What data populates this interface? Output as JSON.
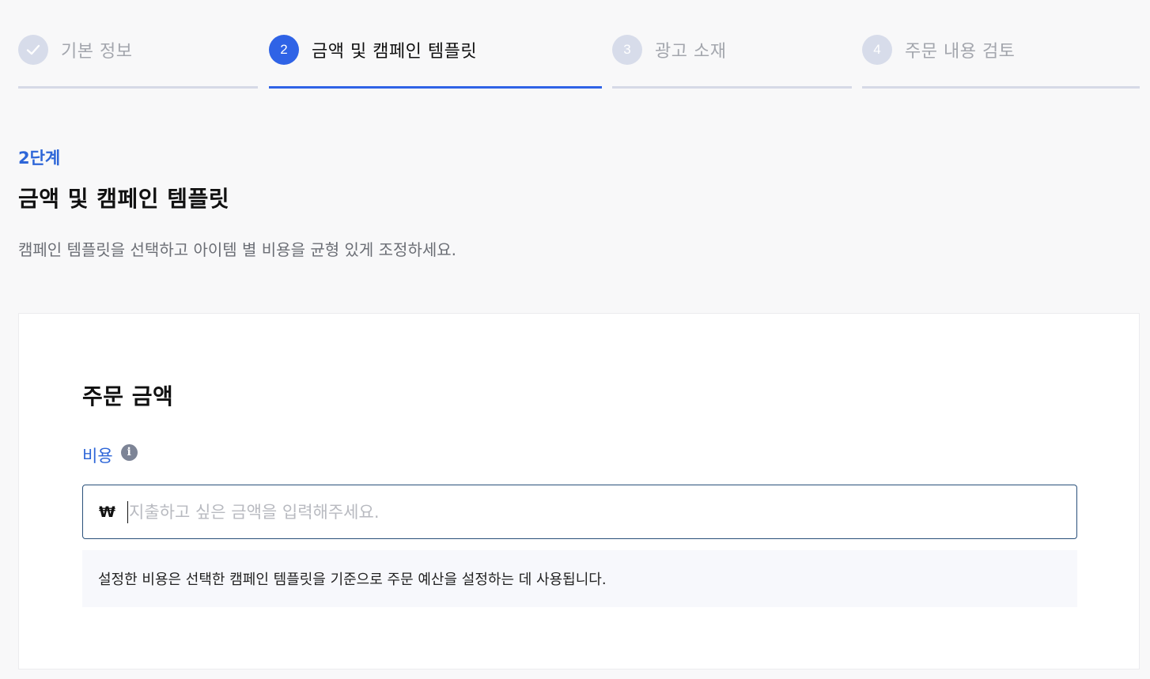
{
  "stepper": {
    "steps": [
      {
        "number": "✓",
        "label": "기본 정보",
        "state": "done"
      },
      {
        "number": "2",
        "label": "금액 및 캠페인 템플릿",
        "state": "active"
      },
      {
        "number": "3",
        "label": "광고 소재",
        "state": "todo"
      },
      {
        "number": "4",
        "label": "주문 내용 검토",
        "state": "todo"
      }
    ]
  },
  "header": {
    "stage": "2단계",
    "title": "금액 및 캠페인 템플릿",
    "description": "캠페인 템플릿을 선택하고 아이템 별 비용을 균형 있게 조정하세요."
  },
  "order_amount": {
    "title": "주문 금액",
    "cost_label": "비용",
    "info_icon": "info-icon",
    "currency_symbol": "₩",
    "input_value": "",
    "input_placeholder": "지출하고 싶은 금액을 입력해주세요.",
    "help_text": "설정한 비용은 선택한 캠페인 템플릿을 기준으로 주문 예산을 설정하는 데 사용됩니다."
  },
  "colors": {
    "accent": "#2f63e6",
    "label_blue": "#2e66d8",
    "inactive_circle": "#d7dcea",
    "inactive_bar": "#d6d9e6",
    "input_border": "#29507a",
    "help_bg": "#f7f8fc"
  }
}
